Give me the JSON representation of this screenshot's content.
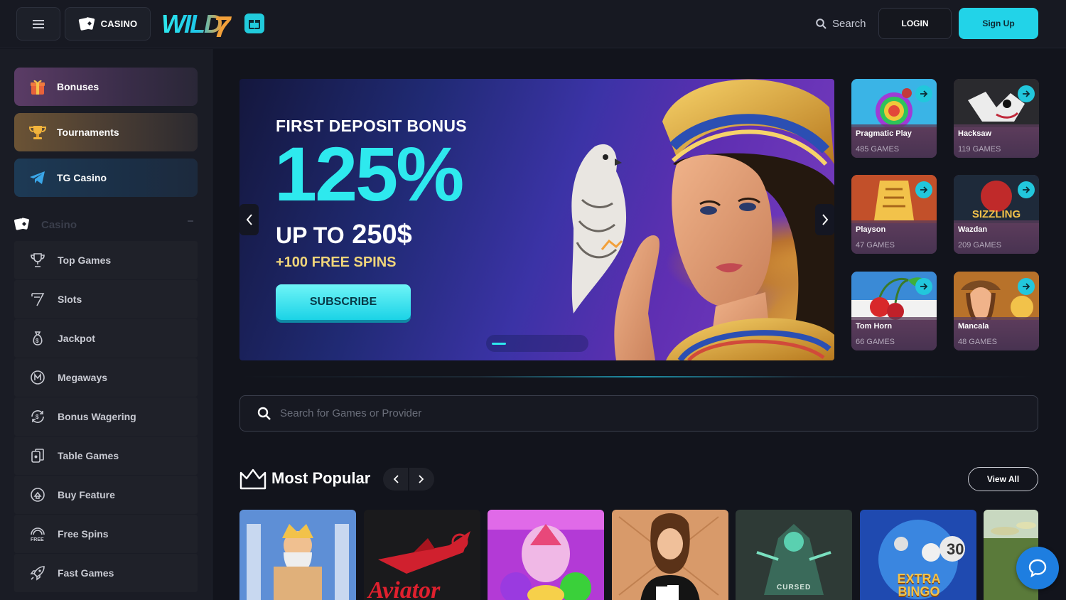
{
  "header": {
    "casino_label": "CASINO",
    "logo_text": "WILD7",
    "search_label": "Search",
    "login_label": "LOGIN",
    "signup_label": "Sign Up"
  },
  "sidebar": {
    "promos": [
      {
        "label": "Bonuses",
        "icon": "gift-icon"
      },
      {
        "label": "Tournaments",
        "icon": "trophy-icon"
      },
      {
        "label": "TG Casino",
        "icon": "telegram-icon"
      }
    ],
    "section_label": "Casino",
    "items": [
      {
        "label": "Top Games",
        "icon": "trophy-outline-icon"
      },
      {
        "label": "Slots",
        "icon": "seven-icon"
      },
      {
        "label": "Jackpot",
        "icon": "money-bag-icon"
      },
      {
        "label": "Megaways",
        "icon": "megaways-icon"
      },
      {
        "label": "Bonus Wagering",
        "icon": "wagering-icon"
      },
      {
        "label": "Table Games",
        "icon": "cards-icon"
      },
      {
        "label": "Buy Feature",
        "icon": "buy-feature-icon"
      },
      {
        "label": "Free Spins",
        "icon": "free-spins-icon"
      },
      {
        "label": "Fast Games",
        "icon": "rocket-icon"
      }
    ]
  },
  "banner": {
    "subtitle": "FIRST DEPOSIT BONUS",
    "percent": "125%",
    "up_to": "UP TO",
    "amount": "250$",
    "spins": "+100 FREE SPINS",
    "cta": "SUBSCRIBE"
  },
  "providers": [
    {
      "name": "Pragmatic Play",
      "count": "485 GAMES"
    },
    {
      "name": "Hacksaw",
      "count": "119 GAMES"
    },
    {
      "name": "Playson",
      "count": "47 GAMES"
    },
    {
      "name": "Wazdan",
      "count": "209 GAMES"
    },
    {
      "name": "Tom Horn",
      "count": "66 GAMES"
    },
    {
      "name": "Mancala",
      "count": "48 GAMES"
    }
  ],
  "game_search": {
    "placeholder": "Search for Games or Provider"
  },
  "most_popular": {
    "title": "Most Popular",
    "view_all": "View All",
    "games": [
      {
        "label": ""
      },
      {
        "label": "Aviator"
      },
      {
        "label": ""
      },
      {
        "label": ""
      },
      {
        "label": "CURSED"
      },
      {
        "label": "EXTRA BINGO"
      },
      {
        "label": ""
      }
    ]
  },
  "colors": {
    "accent": "#22d3e8",
    "background": "#12141c",
    "sidebar": "#1a1c25"
  }
}
